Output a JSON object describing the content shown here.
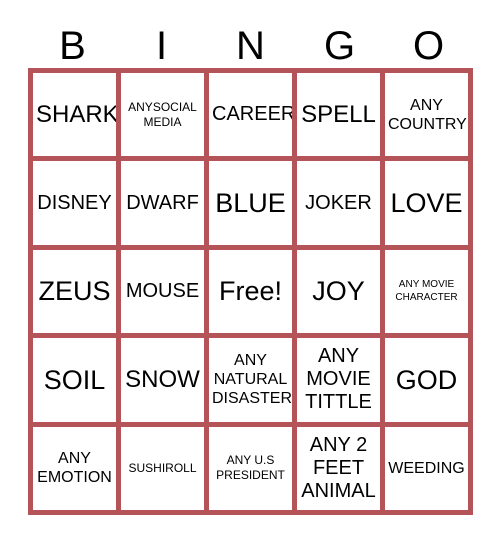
{
  "header": {
    "letters": [
      "B",
      "I",
      "N",
      "G",
      "O"
    ]
  },
  "colors": {
    "grid_line": "#b55458",
    "cell_background": "#ffffff",
    "text": "#000000",
    "page_background": "#ffffff"
  },
  "grid": {
    "columns": 5,
    "rows": 5,
    "free_space_index": 12,
    "cells": [
      {
        "text": "SHARK",
        "size": "fs-lg"
      },
      {
        "text": "ANYSOCIAL\nMEDIA",
        "size": "fs-xs"
      },
      {
        "text": "CAREER",
        "size": "fs-md"
      },
      {
        "text": "SPELL",
        "size": "fs-lg"
      },
      {
        "text": "ANY\nCOUNTRY",
        "size": "fs-sm"
      },
      {
        "text": "DISNEY",
        "size": "fs-md"
      },
      {
        "text": "DWARF",
        "size": "fs-md"
      },
      {
        "text": "BLUE",
        "size": "fs-xl"
      },
      {
        "text": "JOKER",
        "size": "fs-md"
      },
      {
        "text": "LOVE",
        "size": "fs-xl"
      },
      {
        "text": "ZEUS",
        "size": "fs-xl"
      },
      {
        "text": "MOUSE",
        "size": "fs-md"
      },
      {
        "text": "Free!",
        "size": "fs-xl"
      },
      {
        "text": "JOY",
        "size": "fs-xl"
      },
      {
        "text": "ANY MOVIE\nCHARACTER",
        "size": "fs-xxs"
      },
      {
        "text": "SOIL",
        "size": "fs-xl"
      },
      {
        "text": "SNOW",
        "size": "fs-lg"
      },
      {
        "text": "ANY\nNATURAL\nDISASTER",
        "size": "fs-sm"
      },
      {
        "text": "ANY\nMOVIE\nTITTLE",
        "size": "fs-md"
      },
      {
        "text": "GOD",
        "size": "fs-xl"
      },
      {
        "text": "ANY\nEMOTION",
        "size": "fs-sm"
      },
      {
        "text": "SUSHIROLL",
        "size": "fs-xs"
      },
      {
        "text": "ANY U.S\nPRESIDENT",
        "size": "fs-xs"
      },
      {
        "text": "ANY 2\nFEET\nANIMAL",
        "size": "fs-md"
      },
      {
        "text": "WEEDING",
        "size": "fs-sm"
      }
    ]
  }
}
